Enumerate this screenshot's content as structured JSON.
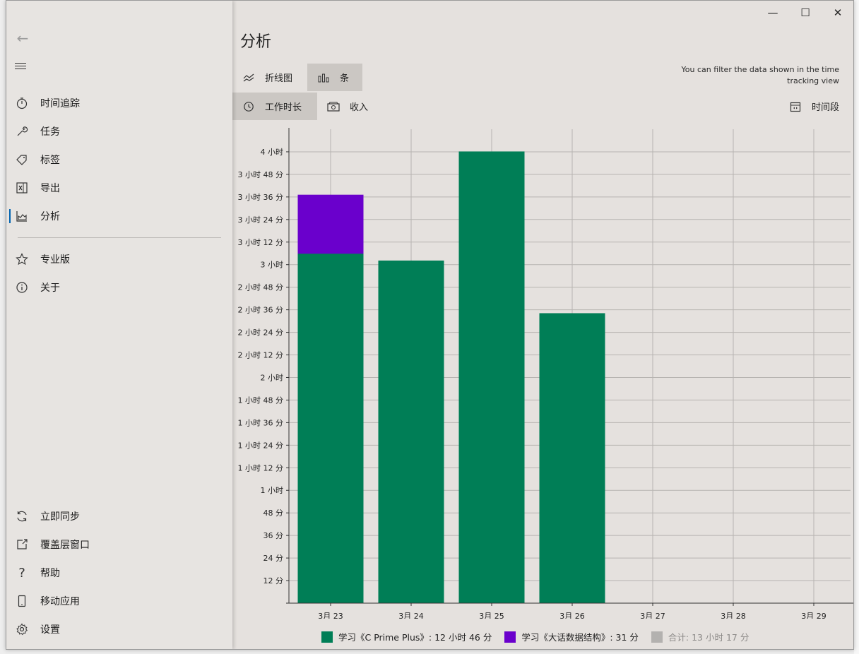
{
  "window": {
    "title": "分析",
    "controls": {
      "minimize": "—",
      "maximize": "☐",
      "close": "✕"
    },
    "hint": "You can filter the data shown in the time tracking view"
  },
  "sidebar": {
    "back_icon": "back-arrow-icon",
    "menu_icon": "hamburger-menu-icon",
    "items": [
      {
        "label": "时间追踪",
        "icon": "stopwatch-icon"
      },
      {
        "label": "任务",
        "icon": "wrench-icon"
      },
      {
        "label": "标签",
        "icon": "tag-icon"
      },
      {
        "label": "导出",
        "icon": "excel-export-icon"
      },
      {
        "label": "分析",
        "icon": "chart-icon",
        "active": true
      },
      {
        "label": "专业版",
        "icon": "star-icon"
      },
      {
        "label": "关于",
        "icon": "info-icon"
      }
    ],
    "bottom_items": [
      {
        "label": "立即同步",
        "icon": "sync-icon"
      },
      {
        "label": "覆盖层窗口",
        "icon": "overlay-window-icon"
      },
      {
        "label": "帮助",
        "icon": "help-icon"
      },
      {
        "label": "移动应用",
        "icon": "mobile-icon"
      },
      {
        "label": "设置",
        "icon": "gear-icon"
      }
    ]
  },
  "tabs": {
    "chart_types": [
      {
        "label": "折线图",
        "icon": "line-chart-icon",
        "selected": false
      },
      {
        "label": "条",
        "icon": "bar-chart-icon",
        "selected": true
      }
    ],
    "metrics": [
      {
        "label": "工作时长",
        "icon": "clock-icon",
        "selected": true
      },
      {
        "label": "收入",
        "icon": "money-icon",
        "selected": false
      }
    ],
    "period": {
      "label": "时间段",
      "icon": "calendar-icon"
    }
  },
  "chart_data": {
    "type": "bar",
    "stacked": true,
    "categories": [
      "3月 23",
      "3月 24",
      "3月 25",
      "3月 26",
      "3月 27",
      "3月 28",
      "3月 29",
      "3月"
    ],
    "series": [
      {
        "name": "学习《C Prime Plus》: 12 小时 46 分",
        "color": "#007e56",
        "values_min": [
          186,
          182,
          240,
          154,
          0,
          0,
          0,
          0
        ]
      },
      {
        "name": "学习《大话数据结构》: 31 分",
        "color": "#6a00cc",
        "values_min": [
          31,
          0,
          0,
          0,
          0,
          0,
          0,
          0
        ]
      }
    ],
    "total_label": "合计: 13 小时 17 分",
    "total_color": "#b3b1af",
    "ylim_min": [
      0,
      252
    ],
    "yticks_min": [
      12,
      24,
      36,
      48,
      60,
      72,
      84,
      96,
      108,
      120,
      132,
      144,
      156,
      168,
      180,
      192,
      204,
      216,
      228,
      240
    ],
    "ytick_labels": [
      "12 分",
      "24 分",
      "36 分",
      "48 分",
      "1 小时",
      "1 小时 12 分",
      "1 小时 24 分",
      "1 小时 36 分",
      "1 小时 48 分",
      "2 小时",
      "2 小时 12 分",
      "2 小时 24 分",
      "2 小时 36 分",
      "2 小时 48 分",
      "3 小时",
      "3 小时 12 分",
      "3 小时 24 分",
      "3 小时 36 分",
      "3 小时 48 分",
      "4 小时"
    ],
    "grid": true,
    "legend_position": "bottom"
  }
}
